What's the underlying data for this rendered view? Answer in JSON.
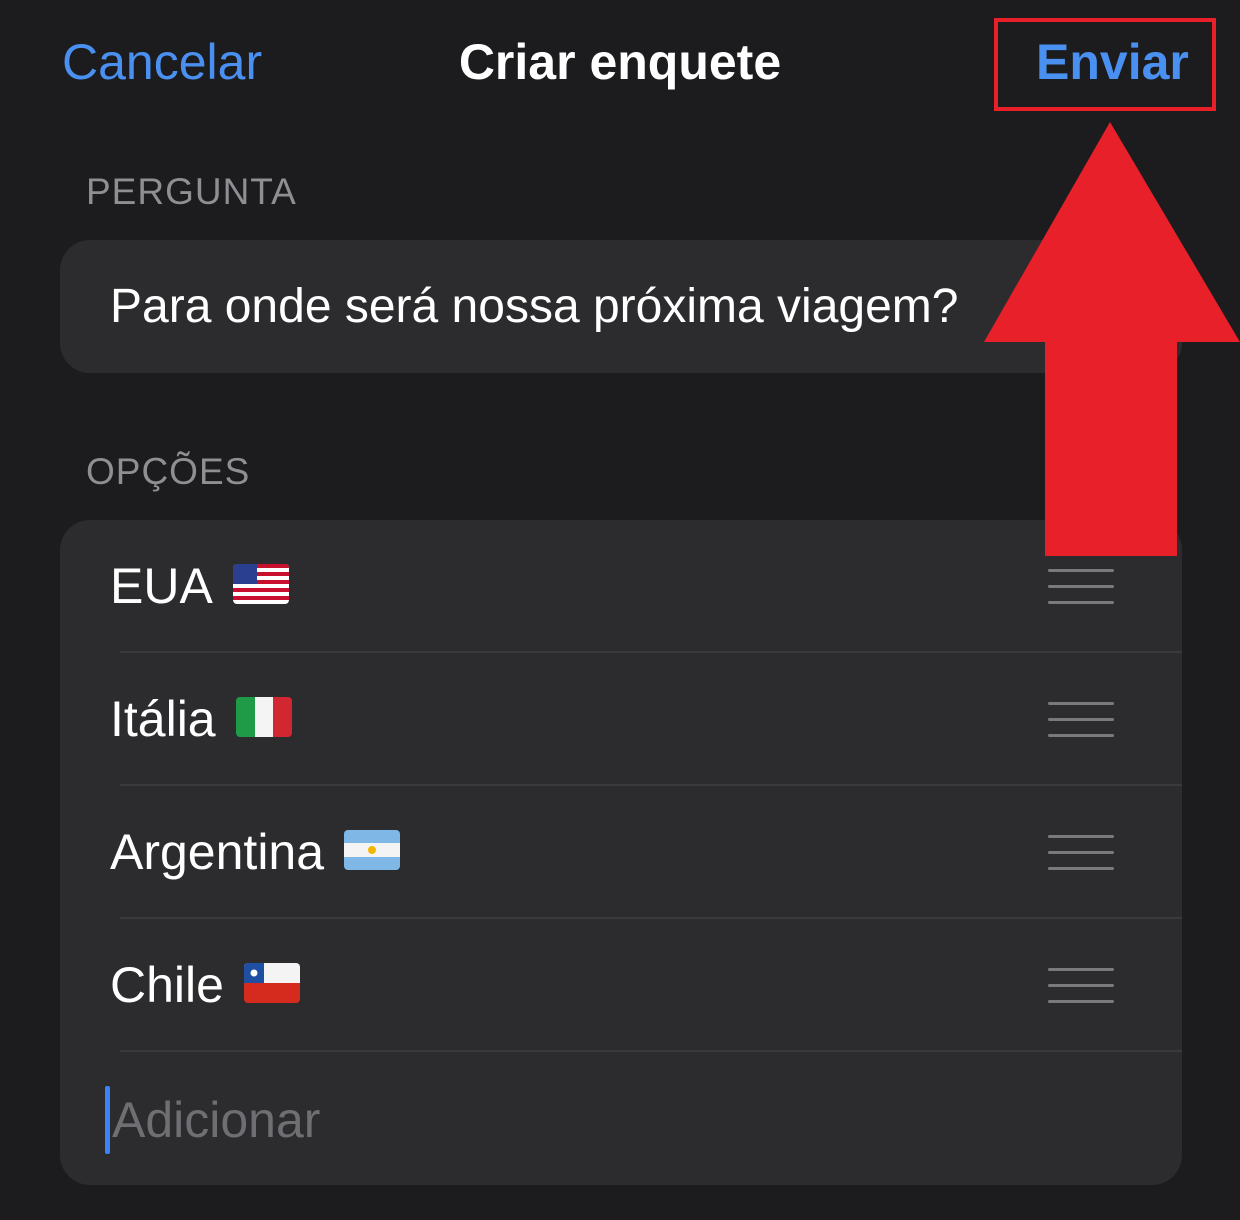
{
  "header": {
    "cancel_label": "Cancelar",
    "title": "Criar enquete",
    "send_label": "Enviar"
  },
  "question": {
    "section_label": "PERGUNTA",
    "value": "Para onde será nossa próxima viagem?"
  },
  "options": {
    "section_label": "OPÇÕES",
    "items": [
      {
        "label": "EUA",
        "flag_icon": "us-flag-icon"
      },
      {
        "label": "Itália",
        "flag_icon": "italy-flag-icon"
      },
      {
        "label": "Argentina",
        "flag_icon": "argentina-flag-icon"
      },
      {
        "label": "Chile",
        "flag_icon": "chile-flag-icon"
      }
    ],
    "add_placeholder": "Adicionar"
  },
  "colors": {
    "background": "#1c1c1e",
    "card": "#2c2c2e",
    "accent": "#4a90f0",
    "annotation_red": "#e8202a"
  }
}
